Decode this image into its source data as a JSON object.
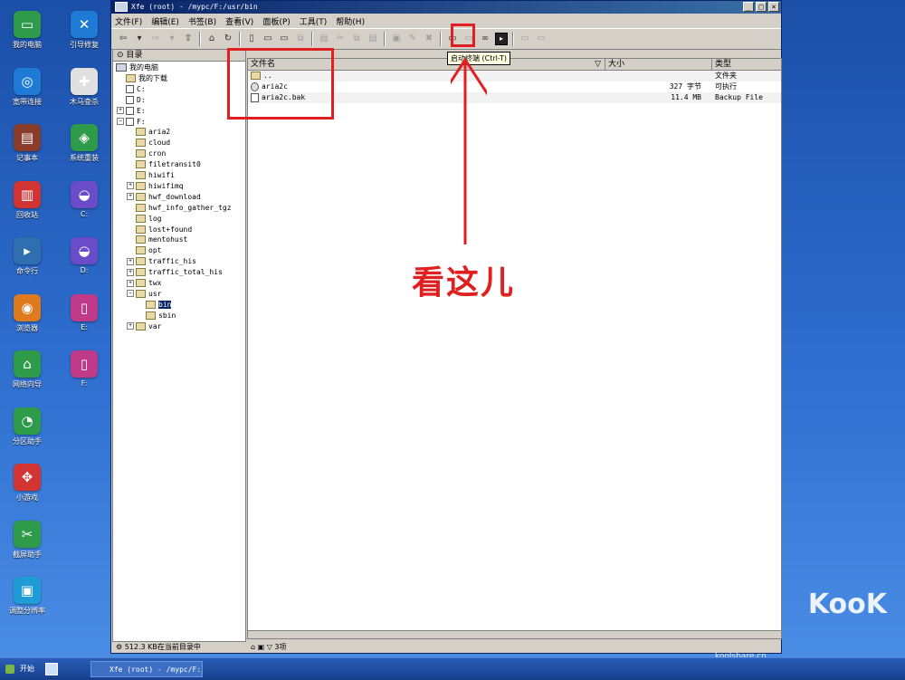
{
  "desktop": {
    "icons": [
      {
        "label": "我的电脑",
        "icon": "monitor-icon",
        "color": "#2e9b4a"
      },
      {
        "label": "引导修复",
        "icon": "wrench-icon",
        "color": "#1f7ad6"
      },
      {
        "label": "宽带连接",
        "icon": "globe-icon",
        "color": "#1f7ad6"
      },
      {
        "label": "木马查杀",
        "icon": "first-aid-icon",
        "color": "#e0e0e0"
      },
      {
        "label": "记事本",
        "icon": "notebook-icon",
        "color": "#8a3d2a"
      },
      {
        "label": "系统重装",
        "icon": "windows-icon",
        "color": "#2e9b4a"
      },
      {
        "label": "回收站",
        "icon": "trash-icon",
        "color": "#d23434"
      },
      {
        "label": "C:",
        "icon": "drive-icon",
        "color": "#6a4cc8"
      },
      {
        "label": "命令行",
        "icon": "terminal-icon",
        "color": "#2f6fb0"
      },
      {
        "label": "D:",
        "icon": "drive-icon",
        "color": "#6a4cc8"
      },
      {
        "label": "浏览器",
        "icon": "firefox-icon",
        "color": "#e07a1f"
      },
      {
        "label": "E:",
        "icon": "usb-icon",
        "color": "#c03a8a"
      },
      {
        "label": "网络向导",
        "icon": "home-icon",
        "color": "#2e9b4a"
      },
      {
        "label": "F:",
        "icon": "usb-icon",
        "color": "#c03a8a"
      },
      {
        "label": "分区助手",
        "icon": "pie-icon",
        "color": "#2e9b4a"
      },
      {
        "label": "小游戏",
        "icon": "gamepad-icon",
        "color": "#d23434"
      },
      {
        "label": "截屏助手",
        "icon": "scissors-icon",
        "color": "#2e9b4a"
      },
      {
        "label": "调整分辨率",
        "icon": "display-icon",
        "color": "#1f9bd6"
      }
    ]
  },
  "window": {
    "title": "Xfe (root) - /mypc/F:/usr/bin",
    "menu": [
      "文件(F)",
      "编辑(E)",
      "书签(B)",
      "查看(V)",
      "面板(P)",
      "工具(T)",
      "帮助(H)"
    ],
    "tooltip": "启动终端 (Ctrl-T)",
    "tree_header": "目录",
    "tree": [
      {
        "label": "我的电脑",
        "icon": "computer-icon",
        "selected": false
      },
      {
        "label": "我的下载",
        "icon": "folder-icon",
        "selected": false
      },
      {
        "label": "C:",
        "icon": "drive-icon",
        "selected": false
      },
      {
        "label": "D:",
        "icon": "drive-icon",
        "selected": false
      },
      {
        "label": "E:",
        "icon": "drive-icon",
        "selected": false
      },
      {
        "label": "F:",
        "icon": "drive-icon",
        "selected": false
      },
      {
        "label": "aria2",
        "icon": "folder-icon",
        "selected": false
      },
      {
        "label": "cloud",
        "icon": "folder-icon",
        "selected": false
      },
      {
        "label": "cron",
        "icon": "folder-icon",
        "selected": false
      },
      {
        "label": "filetransit0",
        "icon": "folder-icon",
        "selected": false
      },
      {
        "label": "hiwifi",
        "icon": "folder-icon",
        "selected": false
      },
      {
        "label": "hiwifimq",
        "icon": "folder-icon",
        "selected": false
      },
      {
        "label": "hwf_download",
        "icon": "folder-icon",
        "selected": false
      },
      {
        "label": "hwf_info_gather_tgz",
        "icon": "folder-icon",
        "selected": false
      },
      {
        "label": "log",
        "icon": "folder-icon",
        "selected": false
      },
      {
        "label": "lost+found",
        "icon": "folder-icon",
        "selected": false
      },
      {
        "label": "mentohust",
        "icon": "folder-icon",
        "selected": false
      },
      {
        "label": "opt",
        "icon": "folder-icon",
        "selected": false
      },
      {
        "label": "traffic_his",
        "icon": "folder-icon",
        "selected": false
      },
      {
        "label": "traffic_total_his",
        "icon": "folder-icon",
        "selected": false
      },
      {
        "label": "twx",
        "icon": "folder-icon",
        "selected": false
      },
      {
        "label": "usr",
        "icon": "folder-icon",
        "selected": false
      },
      {
        "label": "bin",
        "icon": "folder-icon",
        "selected": true
      },
      {
        "label": "sbin",
        "icon": "folder-icon",
        "selected": false
      },
      {
        "label": "var",
        "icon": "folder-icon",
        "selected": false
      }
    ],
    "columns": {
      "name": "文件名",
      "size": "大小",
      "type": "类型"
    },
    "files": [
      {
        "name": "..",
        "size": "",
        "type": "文件夹",
        "icon": "folder-icon"
      },
      {
        "name": "aria2c",
        "size": "327 字节",
        "type": "可执行",
        "icon": "executable-icon"
      },
      {
        "name": "aria2c.bak",
        "size": "11.4 MB",
        "type": "Backup File",
        "icon": "file-icon"
      }
    ],
    "left_status": "512.3 KB在当前目录中",
    "right_status": "3项"
  },
  "annotation": {
    "text": "看这儿",
    "color": "#e02020"
  },
  "taskbar": {
    "start_label": "开始",
    "task_label": "Xfe (root) - /mypc/F:/u"
  },
  "watermark": {
    "brand": "KooK",
    "site": "koolshare.cn"
  }
}
